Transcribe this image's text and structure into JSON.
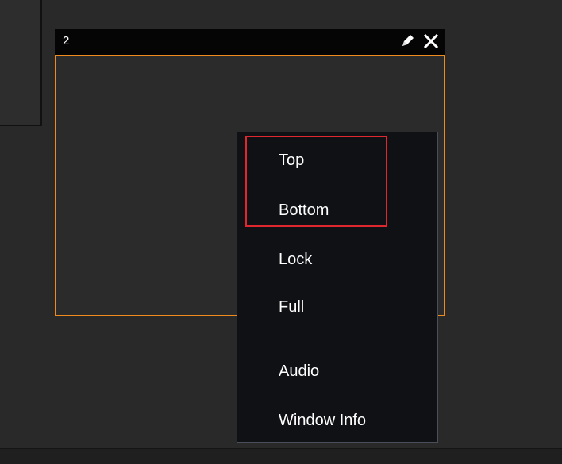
{
  "workspace": {
    "window": {
      "number": "2",
      "edit_icon": "pencil-icon",
      "close_icon": "close-icon",
      "border_color": "#ef8a1f"
    }
  },
  "context_menu": {
    "items": [
      {
        "label": "Top"
      },
      {
        "label": "Bottom"
      },
      {
        "label": "Lock"
      },
      {
        "label": "Full"
      },
      {
        "label": "Audio"
      },
      {
        "label": "Window Info"
      }
    ],
    "highlight_color": "#e0262f"
  }
}
